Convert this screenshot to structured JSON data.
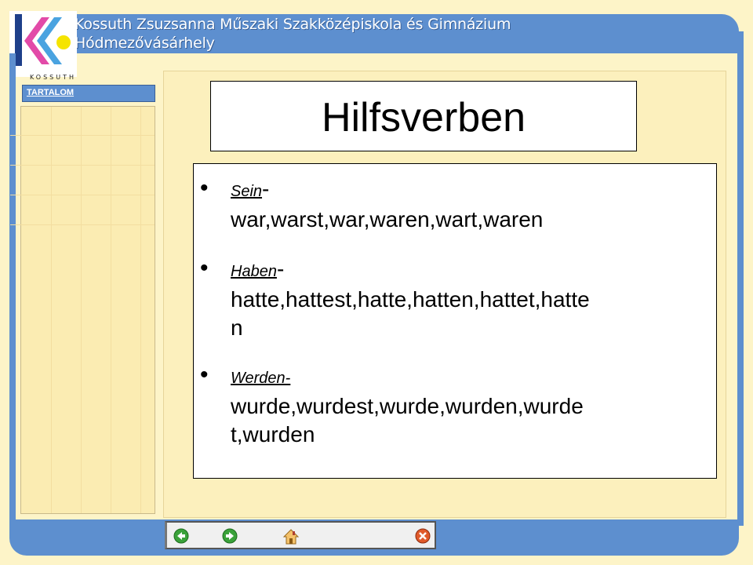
{
  "header": {
    "school_name": "Kossuth Zsuzsanna Műszaki Szakközépiskola és Gimnázium",
    "city": "Hódmezővásárhely",
    "logo_text": "KOSSUTH"
  },
  "sidebar": {
    "title": "TARTALOM"
  },
  "slide": {
    "title": "Hilfsverben",
    "items": [
      {
        "term": "Sein",
        "dash": "-",
        "forms": "war,warst,war,waren,wart,waren"
      },
      {
        "term": "Haben",
        "dash": "-",
        "forms_line1": "hatte,hattest,hatte,hatten,hattet,hatte",
        "forms_line2": "n"
      },
      {
        "term": "Werden-",
        "dash": "",
        "forms_line1": "wurde,wurdest,wurde,wurden,wurde",
        "forms_line2": "t,wurden"
      }
    ]
  },
  "nav": {
    "buttons": [
      "back-icon",
      "forward-icon",
      "home-icon",
      "close-icon"
    ]
  },
  "colors": {
    "band": "#5d8fcf",
    "background": "#fdf4c8"
  }
}
